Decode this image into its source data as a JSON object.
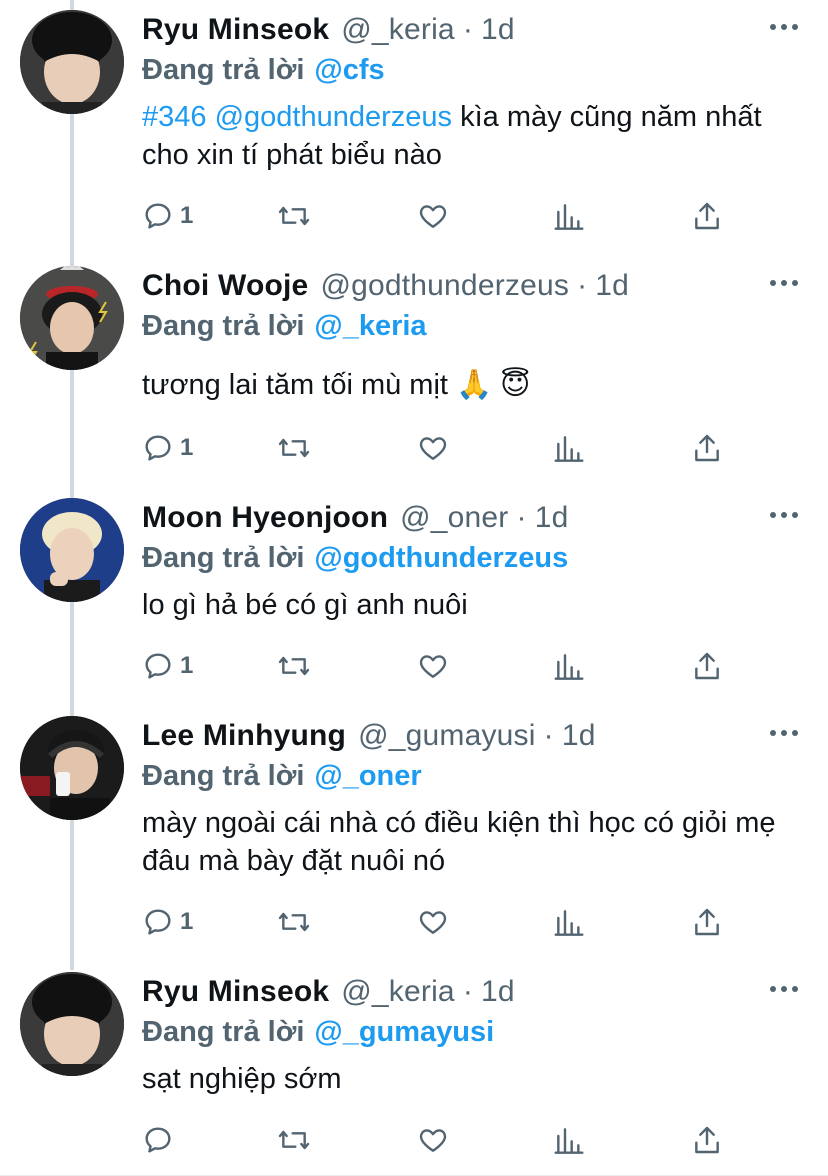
{
  "tweets": [
    {
      "name": "Ryu Minseok",
      "handle": "@_keria",
      "time": "1d",
      "reply_prefix": "Đang trả lời",
      "reply_to": "@cfs",
      "body_link1": "#346",
      "body_link2": "@godthunderzeus",
      "body_text": " kìa mày cũng năm nhất cho xin tí phát biểu nào",
      "reply_count": "1"
    },
    {
      "name": "Choi Wooje",
      "handle": "@godthunderzeus",
      "time": "1d",
      "reply_prefix": "Đang trả lời",
      "reply_to": "@_keria",
      "body_text": "tương lai tăm tối mù mịt 🙏 😇",
      "reply_count": "1"
    },
    {
      "name": "Moon Hyeonjoon",
      "handle": "@_oner",
      "time": "1d",
      "reply_prefix": "Đang trả lời",
      "reply_to": "@godthunderzeus",
      "body_text": "lo gì hả bé có gì anh nuôi",
      "reply_count": "1"
    },
    {
      "name": "Lee Minhyung",
      "handle": "@_gumayusi",
      "time": "1d",
      "reply_prefix": "Đang trả lời",
      "reply_to": "@_oner",
      "body_text": "mày ngoài cái nhà có điều kiện thì học có giỏi mẹ đâu mà bày đặt nuôi nó",
      "reply_count": "1"
    },
    {
      "name": "Ryu Minseok",
      "handle": "@_keria",
      "time": "1d",
      "reply_prefix": "Đang trả lời",
      "reply_to": "@_gumayusi",
      "body_text": "sạt nghiệp sớm",
      "reply_count": ""
    }
  ],
  "separator": "·",
  "icons": [
    "reply-icon",
    "retweet-icon",
    "like-icon",
    "analytics-icon",
    "share-icon",
    "more-icon"
  ],
  "colors": {
    "accent": "#1d9bf0",
    "muted": "#536471",
    "text": "#0f1419",
    "thread_line": "#cfd9de"
  }
}
